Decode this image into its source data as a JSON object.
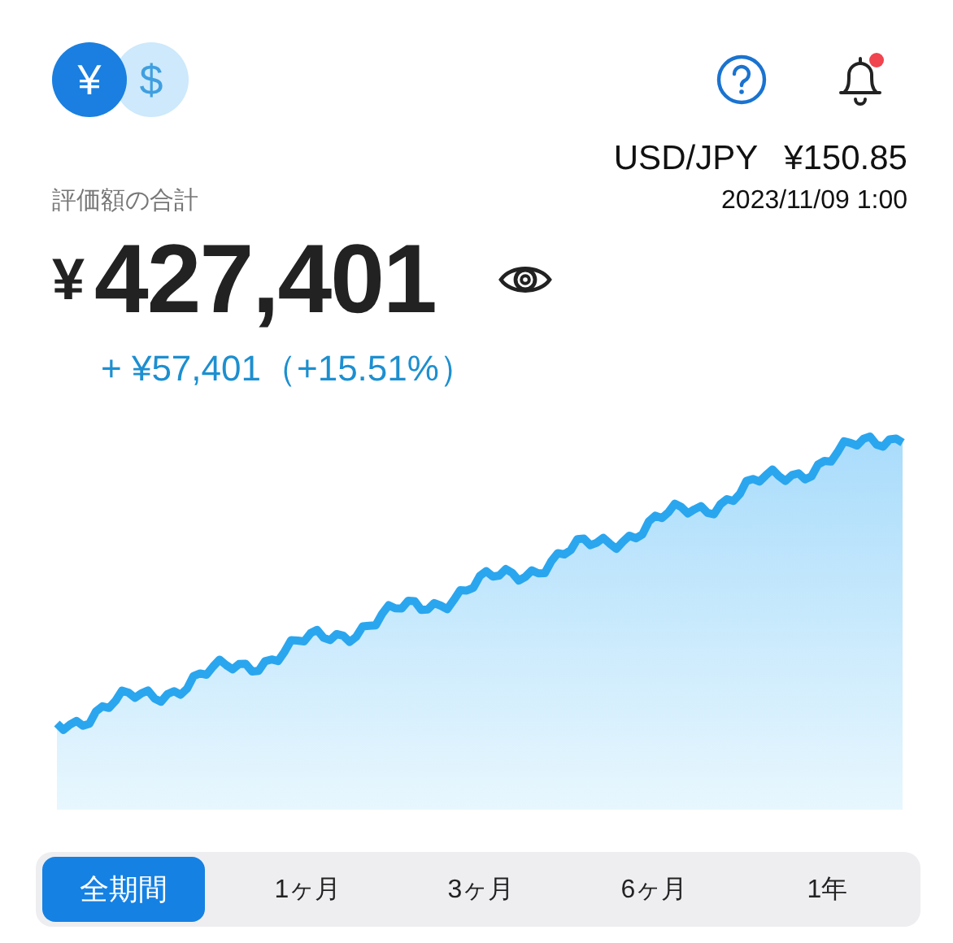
{
  "currency_toggle": [
    {
      "symbol": "¥",
      "selected": true
    },
    {
      "symbol": "$",
      "selected": false
    }
  ],
  "notifications": {
    "unread": true
  },
  "exchange_rate": {
    "pair": "USD/JPY",
    "rate": "¥150.85",
    "timestamp": "2023/11/09 1:00"
  },
  "total": {
    "label": "評価額の合計",
    "currency": "¥",
    "amount": "427,401",
    "change": "+ ¥57,401（+15.51%）"
  },
  "periods": [
    {
      "label": "全期間",
      "selected": true
    },
    {
      "label": "1ヶ月",
      "selected": false
    },
    {
      "label": "3ヶ月",
      "selected": false
    },
    {
      "label": "6ヶ月",
      "selected": false
    },
    {
      "label": "1年",
      "selected": false
    }
  ]
}
